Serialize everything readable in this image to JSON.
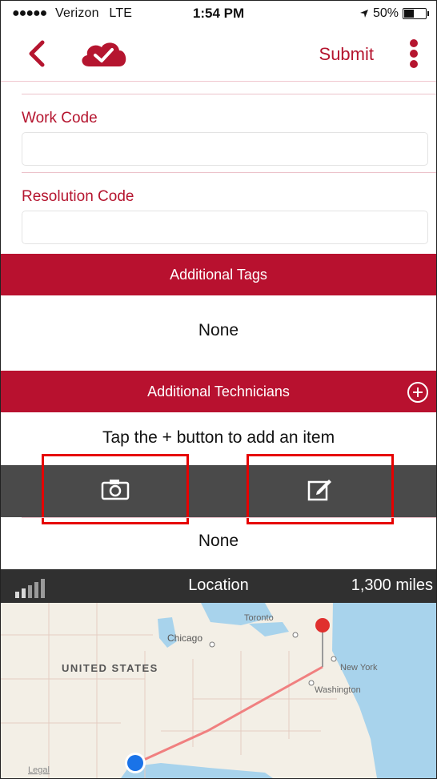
{
  "status_bar": {
    "carrier": "Verizon",
    "network": "LTE",
    "time": "1:54 PM",
    "battery": "50%"
  },
  "nav": {
    "submit_label": "Submit"
  },
  "fields": {
    "work_code": {
      "label": "Work Code",
      "value": ""
    },
    "resolution_code": {
      "label": "Resolution Code",
      "value": ""
    }
  },
  "tags": {
    "header": "Additional Tags",
    "value": "None"
  },
  "technicians": {
    "header": "Additional Technicians",
    "hint": "Tap the + button to add an item"
  },
  "attachments": {
    "value": "None"
  },
  "location": {
    "title": "Location",
    "distance": "1,300 miles"
  },
  "map": {
    "labels": {
      "toronto": "Toronto",
      "chicago": "Chicago",
      "united_states": "UNITED STATES",
      "new_york": "New York",
      "washington": "Washington",
      "legal": "Legal"
    }
  },
  "colors": {
    "accent": "#b8112f",
    "toolbar": "#4a4a4a",
    "highlight": "#e60000"
  }
}
